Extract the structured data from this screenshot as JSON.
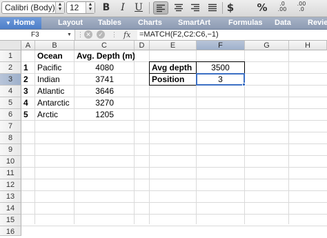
{
  "toolbar": {
    "font_name": "Calibri (Body)",
    "font_size": "12",
    "bold_label": "B",
    "italic_label": "I",
    "underline_label": "U",
    "currency_label": "$",
    "percent_label": "%",
    "inc_decimal_label": ".0\n.00",
    "dec_decimal_label": ".00\n.0",
    "active_alignment": "align-left"
  },
  "ribbon": {
    "tabs": [
      "Home",
      "Layout",
      "Tables",
      "Charts",
      "SmartArt",
      "Formulas",
      "Data",
      "Review"
    ],
    "active_tab": "Home"
  },
  "formula_bar": {
    "name_box": "F3",
    "fx_label": "fx",
    "formula": "=MATCH(F2,C2:C6,−1)"
  },
  "sheet": {
    "columns": [
      "A",
      "B",
      "C",
      "D",
      "E",
      "F",
      "G",
      "H"
    ],
    "rows": [
      "1",
      "2",
      "3",
      "4",
      "5",
      "6",
      "7",
      "8",
      "9",
      "10",
      "11",
      "12",
      "13",
      "14",
      "15",
      "16"
    ],
    "selected_cell": "F3",
    "cells": {
      "B1": "Ocean",
      "C1": "Avg. Depth (m)",
      "A2": "1",
      "B2": "Pacific",
      "C2": "4080",
      "A3": "2",
      "B3": "Indian",
      "C3": "3741",
      "A4": "3",
      "B4": "Atlantic",
      "C4": "3646",
      "A5": "4",
      "B5": "Antarctic",
      "C5": "3270",
      "A6": "5",
      "B6": "Arctic",
      "C6": "1205",
      "E2": "Avg depth",
      "F2": "3500",
      "E3": "Position",
      "F3": "3"
    }
  },
  "colors": {
    "selection": "#3b6fc4",
    "ribbon_tab_bg": "#8d9bb3",
    "home_tab_bg": "#4d7fc9"
  }
}
